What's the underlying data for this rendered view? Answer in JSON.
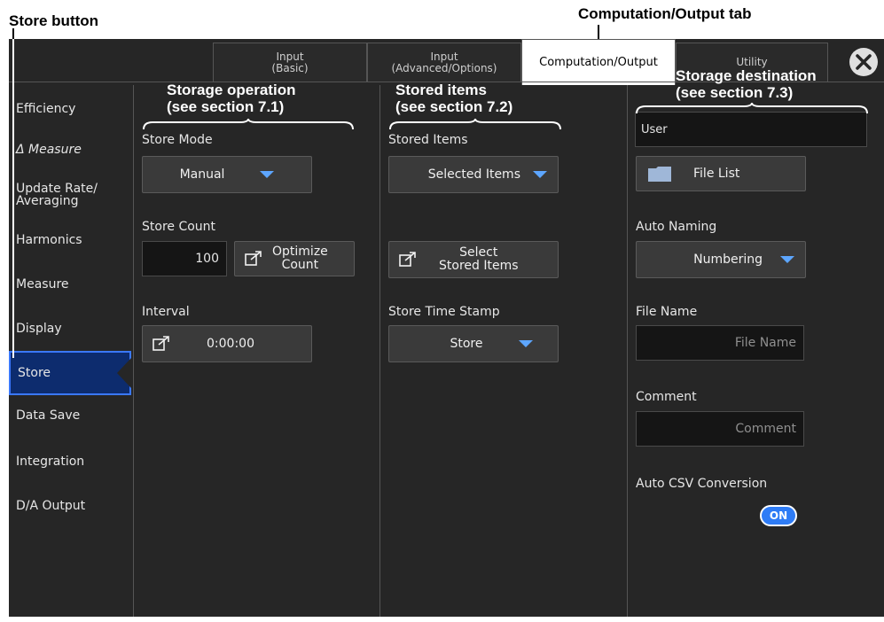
{
  "callouts": {
    "store_button": "Store button",
    "computation_tab": "Computation/Output tab",
    "storage_operation": "Storage operation\n(see section 7.1)",
    "stored_items": "Stored items\n(see section 7.2)",
    "storage_destination": "Storage destination\n(see section 7.3)"
  },
  "tabs": [
    {
      "label": "Input\n(Basic)"
    },
    {
      "label": "Input\n(Advanced/Options)"
    },
    {
      "label": "Computation/Output"
    },
    {
      "label": "Utility"
    }
  ],
  "sidebar": [
    {
      "label": "Efficiency"
    },
    {
      "label": "Δ Measure"
    },
    {
      "label": "Update Rate/\nAveraging"
    },
    {
      "label": "Harmonics"
    },
    {
      "label": "Measure"
    },
    {
      "label": "Display"
    },
    {
      "label": "Store"
    },
    {
      "label": "Data Save"
    },
    {
      "label": "Integration"
    },
    {
      "label": "D/A Output"
    }
  ],
  "store_op": {
    "store_mode_label": "Store Mode",
    "store_mode_value": "Manual",
    "store_count_label": "Store Count",
    "store_count_value": "100",
    "optimize_label": "Optimize\nCount",
    "interval_label": "Interval",
    "interval_value": "0:00:00"
  },
  "stored": {
    "items_label": "Stored Items",
    "items_value": "Selected Items",
    "select_label": "Select\nStored Items",
    "timestamp_label": "Store Time Stamp",
    "timestamp_value": "Store"
  },
  "dest": {
    "path": "User",
    "file_list": "File List",
    "auto_naming_label": "Auto Naming",
    "auto_naming_value": "Numbering",
    "file_name_label": "File Name",
    "file_name_placeholder": "File Name",
    "comment_label": "Comment",
    "comment_placeholder": "Comment",
    "csv_label": "Auto CSV Conversion",
    "csv_toggle": "ON"
  },
  "colors": {
    "accent": "#3a78ff",
    "panel": "#262626",
    "toggle": "#2e7cf6"
  }
}
